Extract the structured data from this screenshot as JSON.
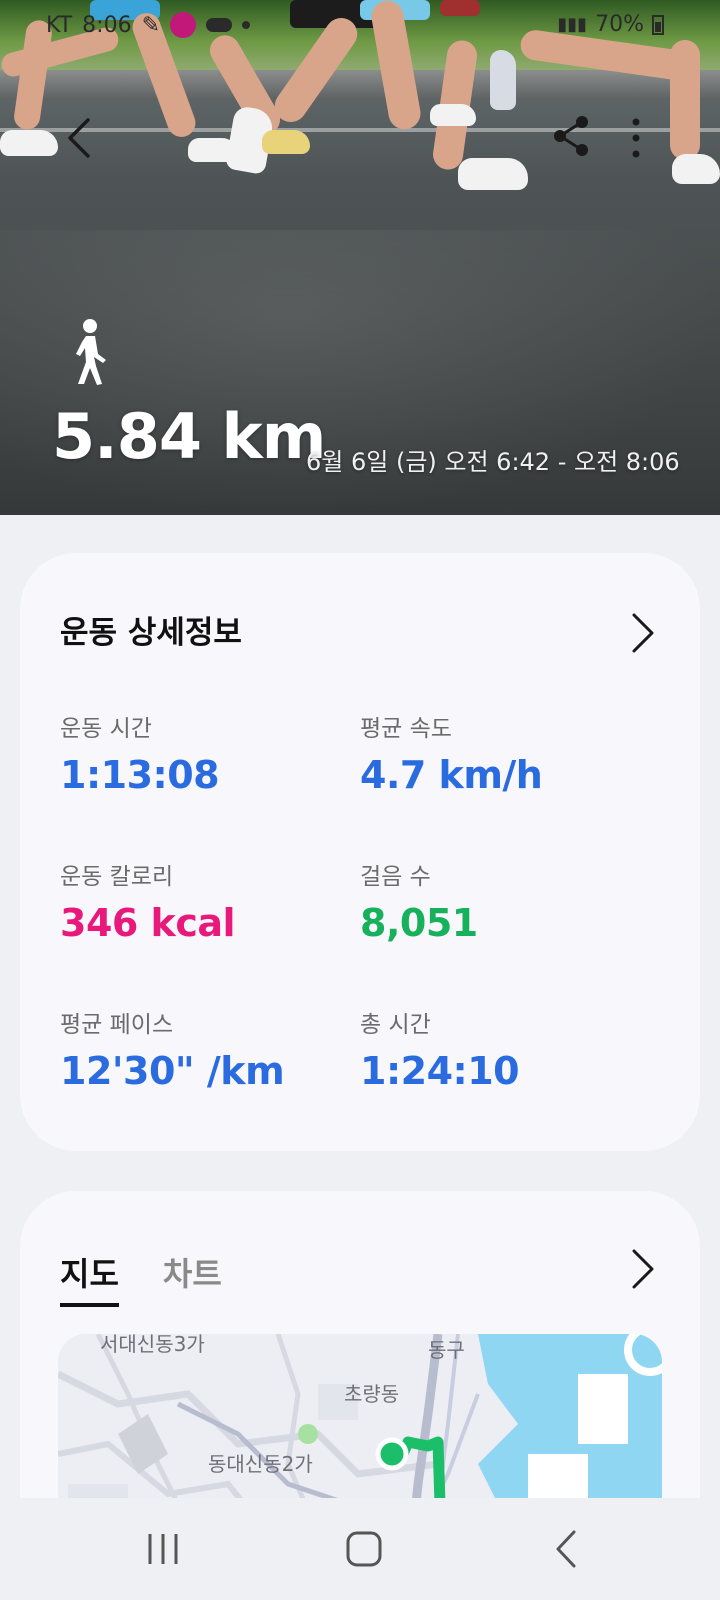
{
  "status_bar": {
    "carrier": "KT",
    "time": "8:06",
    "battery": "70%"
  },
  "header": {
    "distance": "5.84 km",
    "date_range": "6월 6일 (금) 오전 6:42 - 오전 8:06"
  },
  "details": {
    "title": "운동 상세정보",
    "stats": [
      {
        "label": "운동 시간",
        "value": "1:13:08",
        "color": "#2b6be0"
      },
      {
        "label": "평균 속도",
        "value": "4.7 km/h",
        "color": "#2b6be0"
      },
      {
        "label": "운동 칼로리",
        "value": "346 kcal",
        "color": "#e8197a"
      },
      {
        "label": "걸음 수",
        "value": "8,051",
        "color": "#17b05b"
      },
      {
        "label": "평균 페이스",
        "value": "12'30\" /km",
        "color": "#2b6be0"
      },
      {
        "label": "총 시간",
        "value": "1:24:10",
        "color": "#2b6be0"
      }
    ]
  },
  "map_section": {
    "tabs": [
      {
        "label": "지도",
        "active": true
      },
      {
        "label": "차트",
        "active": false
      }
    ],
    "map_labels": [
      "서대신동3가",
      "동구",
      "초량동",
      "동대신동2가"
    ]
  },
  "colors": {
    "accent_blue": "#2b6be0",
    "calorie_pink": "#e8197a",
    "steps_green": "#17b05b",
    "route_green": "#1bbf6a",
    "sea_blue": "#8fd6f2"
  },
  "icons": {
    "back": "chevron-left-icon",
    "share": "share-icon",
    "more": "more-vertical-icon",
    "activity": "walking-person-icon",
    "details_arrow": "chevron-right-icon",
    "nav_recents": "recents-icon",
    "nav_home": "home-icon",
    "nav_back": "back-icon"
  }
}
